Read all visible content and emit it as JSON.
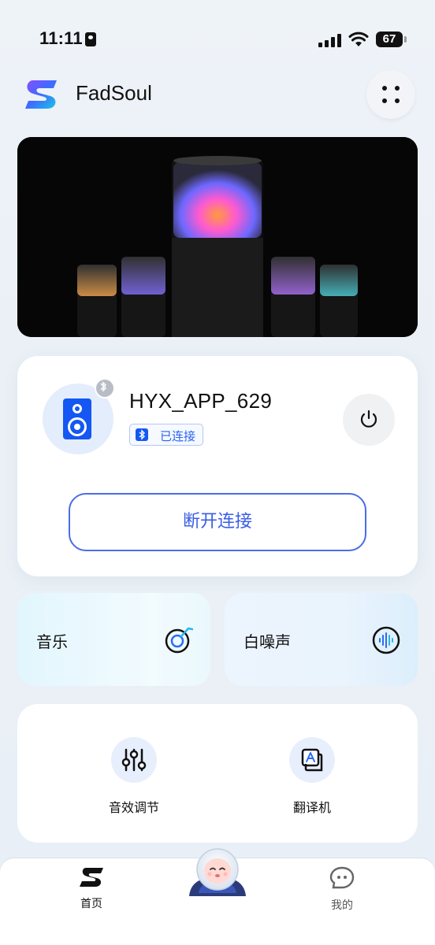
{
  "status_bar": {
    "time": "11:11",
    "battery": "67"
  },
  "header": {
    "app_name": "FadSoul",
    "menu_icon": "grid-dots-icon"
  },
  "device": {
    "name": "HYX_APP_629",
    "status": "已连接",
    "disconnect_label": "断开连接",
    "accent_color": "#1457f2"
  },
  "features": [
    {
      "label": "音乐",
      "icon": "music-disc-icon"
    },
    {
      "label": "白噪声",
      "icon": "sound-wave-icon"
    }
  ],
  "tools": [
    {
      "label": "音效调节",
      "icon": "equalizer-icon"
    },
    {
      "label": "翻译机",
      "icon": "translate-icon"
    }
  ],
  "tabbar": {
    "home_label": "首页",
    "mine_label": "我的"
  }
}
